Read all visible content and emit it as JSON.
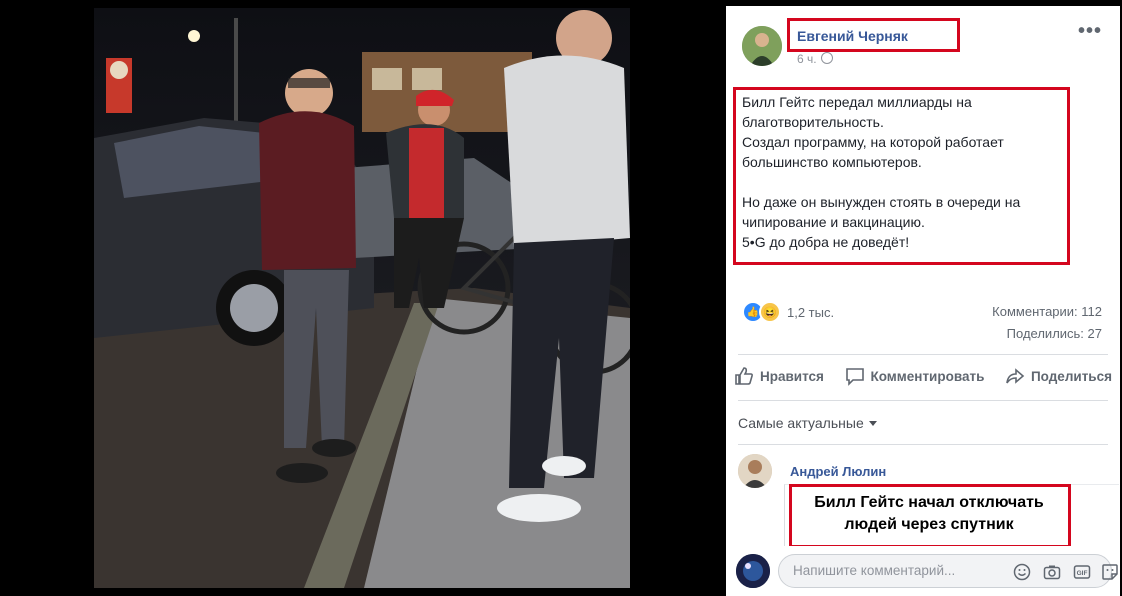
{
  "post": {
    "author": "Евгений Черняк",
    "time": "6 ч.",
    "more": "•••",
    "text": "Билл Гейтс передал миллиарды на благотворительность.\nСоздал программу, на которой работает большинство компьютеров.\n\nНо даже он вынужден стоять в очереди на чипирование и вакцинацию.\n5•G до добра не доведёт!",
    "reaction_count": "1,2 тыс.",
    "comments_stat": "Комментарии: 112",
    "shares_stat": "Поделились: 27"
  },
  "actions": {
    "like": "Нравится",
    "comment": "Комментировать",
    "share": "Поделиться"
  },
  "sort_label": "Самые актуальные",
  "comment": {
    "author": "Андрей Люлин",
    "image_text": "Билл Гейтс начал отключать людей через спутник"
  },
  "composer": {
    "placeholder": "Напишите комментарий..."
  },
  "icons": [
    "globe-icon",
    "like-icon",
    "haha-icon",
    "comment-icon",
    "share-icon",
    "emoji-icon",
    "camera-icon",
    "gif-icon",
    "sticker-icon"
  ],
  "colors": {
    "link": "#385898",
    "highlight": "#d4061e",
    "like_blue": "#2e89ff"
  }
}
